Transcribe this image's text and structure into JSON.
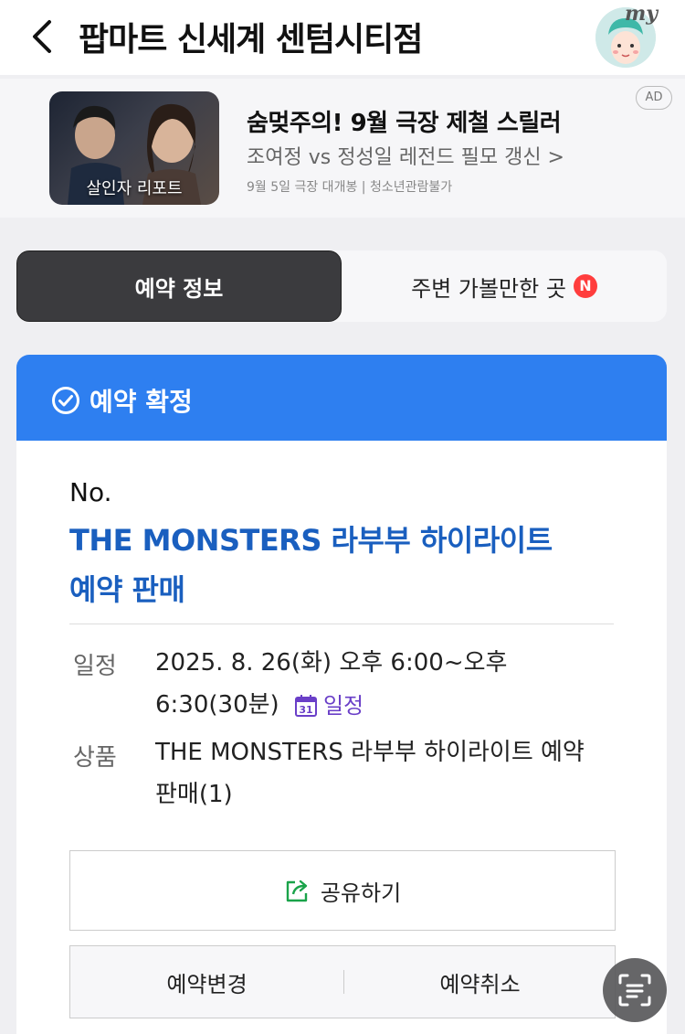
{
  "header": {
    "title": "팝마트 신세계 센텀시티점",
    "avatar_label": "my"
  },
  "ad": {
    "thumb_caption": "살인자 리포트",
    "headline": "숨멎주의! 9월 극장 제철 스릴러",
    "subline": "조여정 vs 정성일 레전드 필모 갱신 >",
    "meta": "9월 5일 극장 대개봉 | 청소년관람불가",
    "badge": "AD"
  },
  "tabs": [
    {
      "label": "예약 정보"
    },
    {
      "label": "주변 가볼만한 곳",
      "badge": "N"
    }
  ],
  "status": {
    "label": "예약 확정"
  },
  "booking": {
    "no_label": "No.",
    "title": "THE MONSTERS 라부부 하이라이트 예약 판매",
    "schedule_label": "일정",
    "schedule_value": "2025. 8. 26(화) 오후 6:00~오후 6:30(30분)",
    "calendar_icon_text": "31",
    "calendar_link": "일정",
    "product_label": "상품",
    "product_value": "THE MONSTERS 라부부 하이라이트 예약 판매(1)"
  },
  "actions": {
    "share": "공유하기",
    "change": "예약변경",
    "cancel": "예약취소"
  },
  "colors": {
    "accent_blue": "#2e7ff0",
    "title_blue": "#1a5fbf",
    "badge_red": "#ff3d3d",
    "calendar_purple": "#6a3fc8",
    "share_green": "#1aa34a"
  }
}
